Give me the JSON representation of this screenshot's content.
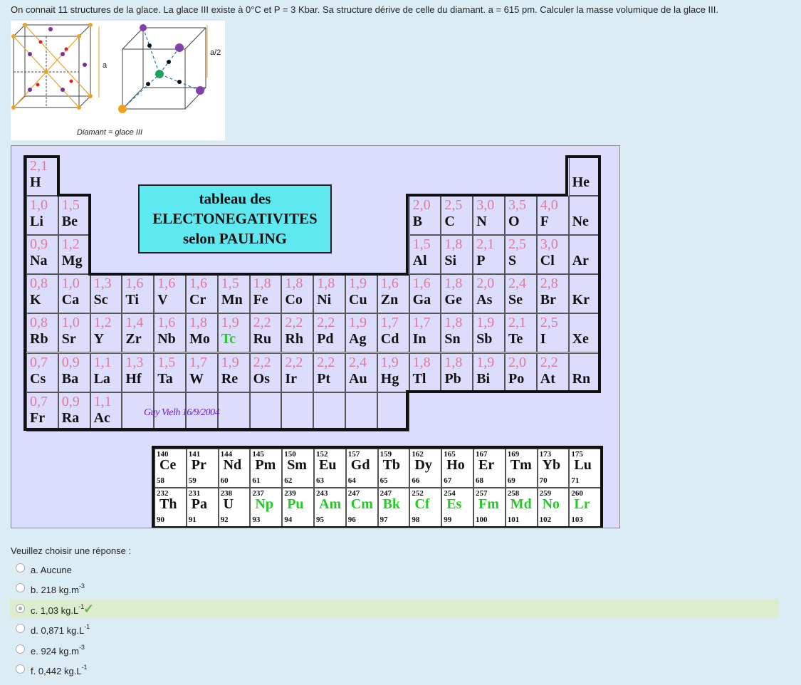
{
  "question": "On connait 11 structures de la glace. La glace III existe à 0°C et P = 3 Kbar. Sa structure dérive de celle du diamant. a = 615 pm. Calculer la masse volumique de la glace III.",
  "figure": {
    "caption": "Diamant = glace III",
    "label_a": "a",
    "label_a2": "a/2"
  },
  "table": {
    "title_lines": [
      "tableau des",
      "ELECTONEGATIVITES",
      "selon PAULING"
    ],
    "signature": "Guy Vielh 16/9/2004",
    "rows": [
      [
        [
          "2,1",
          "H"
        ],
        null,
        null,
        null,
        null,
        null,
        null,
        null,
        null,
        null,
        null,
        null,
        null,
        null,
        null,
        null,
        null,
        [
          "",
          "He"
        ]
      ],
      [
        [
          "1,0",
          "Li"
        ],
        [
          "1,5",
          "Be"
        ],
        null,
        null,
        null,
        null,
        null,
        null,
        null,
        null,
        null,
        null,
        [
          "2,0",
          "B"
        ],
        [
          "2,5",
          "C"
        ],
        [
          "3,0",
          "N"
        ],
        [
          "3,5",
          "O"
        ],
        [
          "4,0",
          "F"
        ],
        [
          "",
          "Ne"
        ]
      ],
      [
        [
          "0,9",
          "Na"
        ],
        [
          "1,2",
          "Mg"
        ],
        null,
        null,
        null,
        null,
        null,
        null,
        null,
        null,
        null,
        null,
        [
          "1,5",
          "Al"
        ],
        [
          "1,8",
          "Si"
        ],
        [
          "2,1",
          "P"
        ],
        [
          "2,5",
          "S"
        ],
        [
          "3,0",
          "Cl"
        ],
        [
          "",
          "Ar"
        ]
      ],
      [
        [
          "0,8",
          "K"
        ],
        [
          "1,0",
          "Ca"
        ],
        [
          "1,3",
          "Sc"
        ],
        [
          "1,6",
          "Ti"
        ],
        [
          "1,6",
          "V"
        ],
        [
          "1,6",
          "Cr"
        ],
        [
          "1,5",
          "Mn"
        ],
        [
          "1,8",
          "Fe"
        ],
        [
          "1,8",
          "Co"
        ],
        [
          "1,8",
          "Ni"
        ],
        [
          "1,9",
          "Cu"
        ],
        [
          "1,6",
          "Zn"
        ],
        [
          "1,6",
          "Ga"
        ],
        [
          "1,8",
          "Ge"
        ],
        [
          "2,0",
          "As"
        ],
        [
          "2,4",
          "Se"
        ],
        [
          "2,8",
          "Br"
        ],
        [
          "",
          "Kr"
        ]
      ],
      [
        [
          "0,8",
          "Rb"
        ],
        [
          "1,0",
          "Sr"
        ],
        [
          "1,2",
          "Y"
        ],
        [
          "1,4",
          "Zr"
        ],
        [
          "1,6",
          "Nb"
        ],
        [
          "1,8",
          "Mo"
        ],
        [
          "1,9",
          "Tc"
        ],
        [
          "2,2",
          "Ru"
        ],
        [
          "2,2",
          "Rh"
        ],
        [
          "2,2",
          "Pd"
        ],
        [
          "1,9",
          "Ag"
        ],
        [
          "1,7",
          "Cd"
        ],
        [
          "1,7",
          "In"
        ],
        [
          "1,8",
          "Sn"
        ],
        [
          "1,9",
          "Sb"
        ],
        [
          "2,1",
          "Te"
        ],
        [
          "2,5",
          "I"
        ],
        [
          "",
          "Xe"
        ]
      ],
      [
        [
          "0,7",
          "Cs"
        ],
        [
          "0,9",
          "Ba"
        ],
        [
          "1,1",
          "La"
        ],
        [
          "1,3",
          "Hf"
        ],
        [
          "1,5",
          "Ta"
        ],
        [
          "1,7",
          "W"
        ],
        [
          "1,9",
          "Re"
        ],
        [
          "2,2",
          "Os"
        ],
        [
          "2,2",
          "Ir"
        ],
        [
          "2,2",
          "Pt"
        ],
        [
          "2,4",
          "Au"
        ],
        [
          "1,9",
          "Hg"
        ],
        [
          "1,8",
          "Tl"
        ],
        [
          "1,8",
          "Pb"
        ],
        [
          "1,9",
          "Bi"
        ],
        [
          "2,0",
          "Po"
        ],
        [
          "2,2",
          "At"
        ],
        [
          "",
          "Rn"
        ]
      ],
      [
        [
          "0,7",
          "Fr"
        ],
        [
          "0,9",
          "Ra"
        ],
        [
          "1,1",
          "Ac"
        ],
        null,
        null,
        null,
        null,
        null,
        null,
        null,
        null,
        null,
        null,
        null,
        null,
        null,
        null,
        null
      ]
    ],
    "green_symbols": [
      "Tc",
      "Np",
      "Pu",
      "Am",
      "Cm",
      "Bk",
      "Cf",
      "Es",
      "Fm",
      "Md",
      "No",
      "Lr"
    ],
    "lanthanides": [
      [
        "140",
        "Ce",
        "58"
      ],
      [
        "141",
        "Pr",
        "59"
      ],
      [
        "144",
        "Nd",
        "60"
      ],
      [
        "145",
        "Pm",
        "61"
      ],
      [
        "150",
        "Sm",
        "62"
      ],
      [
        "152",
        "Eu",
        "63"
      ],
      [
        "157",
        "Gd",
        "64"
      ],
      [
        "159",
        "Tb",
        "65"
      ],
      [
        "162",
        "Dy",
        "66"
      ],
      [
        "165",
        "Ho",
        "67"
      ],
      [
        "167",
        "Er",
        "68"
      ],
      [
        "169",
        "Tm",
        "69"
      ],
      [
        "173",
        "Yb",
        "70"
      ],
      [
        "175",
        "Lu",
        "71"
      ]
    ],
    "actinides": [
      [
        "232",
        "Th",
        "90"
      ],
      [
        "231",
        "Pa",
        "91"
      ],
      [
        "238",
        "U",
        "92"
      ],
      [
        "237",
        "Np",
        "93"
      ],
      [
        "239",
        "Pu",
        "94"
      ],
      [
        "243",
        "Am",
        "95"
      ],
      [
        "247",
        "Cm",
        "96"
      ],
      [
        "247",
        "Bk",
        "97"
      ],
      [
        "252",
        "Cf",
        "98"
      ],
      [
        "254",
        "Es",
        "99"
      ],
      [
        "257",
        "Fm",
        "100"
      ],
      [
        "258",
        "Md",
        "101"
      ],
      [
        "259",
        "No",
        "102"
      ],
      [
        "260",
        "Lr",
        "103"
      ]
    ]
  },
  "prompt": "Veuillez choisir une réponse :",
  "options": [
    {
      "label": "a. Aucune",
      "sup": "",
      "selected": false,
      "correct": false
    },
    {
      "label": "b. 218 kg.m",
      "sup": "-3",
      "selected": false,
      "correct": false
    },
    {
      "label": "c. 1,03 kg.L",
      "sup": "-1",
      "selected": true,
      "correct": true
    },
    {
      "label": "d. 0,871 kg.L",
      "sup": "-1",
      "selected": false,
      "correct": false
    },
    {
      "label": "e. 924 kg.m",
      "sup": "-3",
      "selected": false,
      "correct": false
    },
    {
      "label": "f. 0,442 kg.L",
      "sup": "-1",
      "selected": false,
      "correct": false
    }
  ],
  "correct_mark": "✓",
  "colors": {
    "selected_bg": "#dcedcd",
    "check": "#6ab04c",
    "en_value": "#e07a9a",
    "green_symbol": "#22cc22"
  }
}
